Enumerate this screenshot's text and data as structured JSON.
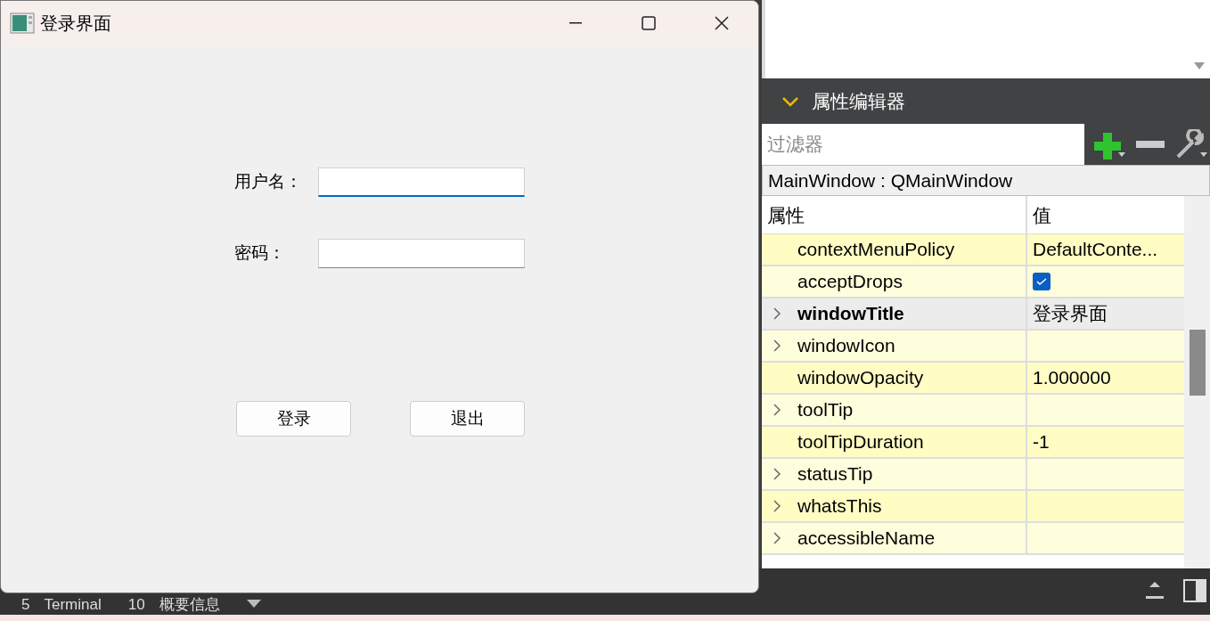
{
  "login_window": {
    "title": "登录界面",
    "fields": [
      {
        "label": "用户名：",
        "focused": true
      },
      {
        "label": "密码：",
        "focused": false
      }
    ],
    "buttons": [
      "登录",
      "退出"
    ]
  },
  "property_editor": {
    "title": "属性编辑器",
    "filter": {
      "placeholder": "过滤器"
    },
    "object_label": "MainWindow : QMainWindow",
    "columns": [
      "属性",
      "值"
    ],
    "rows": [
      {
        "name": "contextMenuPolicy",
        "kind": "text",
        "value": "DefaultConte...",
        "expandable": false,
        "modified": false,
        "selected": false
      },
      {
        "name": "acceptDrops",
        "kind": "checkbox",
        "checked": true,
        "expandable": false,
        "modified": false,
        "selected": false
      },
      {
        "name": "windowTitle",
        "kind": "text",
        "value": "登录界面",
        "expandable": true,
        "modified": true,
        "selected": true
      },
      {
        "name": "windowIcon",
        "kind": "text",
        "expandable": true,
        "modified": false,
        "selected": false
      },
      {
        "name": "windowOpacity",
        "kind": "text",
        "value": "1.000000",
        "expandable": false,
        "modified": false,
        "selected": false
      },
      {
        "name": "toolTip",
        "kind": "text",
        "expandable": true,
        "modified": false,
        "selected": false
      },
      {
        "name": "toolTipDuration",
        "kind": "text",
        "value": "-1",
        "expandable": false,
        "modified": false,
        "selected": false
      },
      {
        "name": "statusTip",
        "kind": "text",
        "expandable": true,
        "modified": false,
        "selected": false
      },
      {
        "name": "whatsThis",
        "kind": "text",
        "expandable": true,
        "modified": false,
        "selected": false
      },
      {
        "name": "accessibleName",
        "kind": "text",
        "expandable": true,
        "modified": false,
        "selected": false
      }
    ]
  },
  "output_bar": {
    "tabs": [
      {
        "number": "5",
        "label": "Terminal"
      },
      {
        "number": "10",
        "label": "概要信息"
      }
    ]
  }
}
